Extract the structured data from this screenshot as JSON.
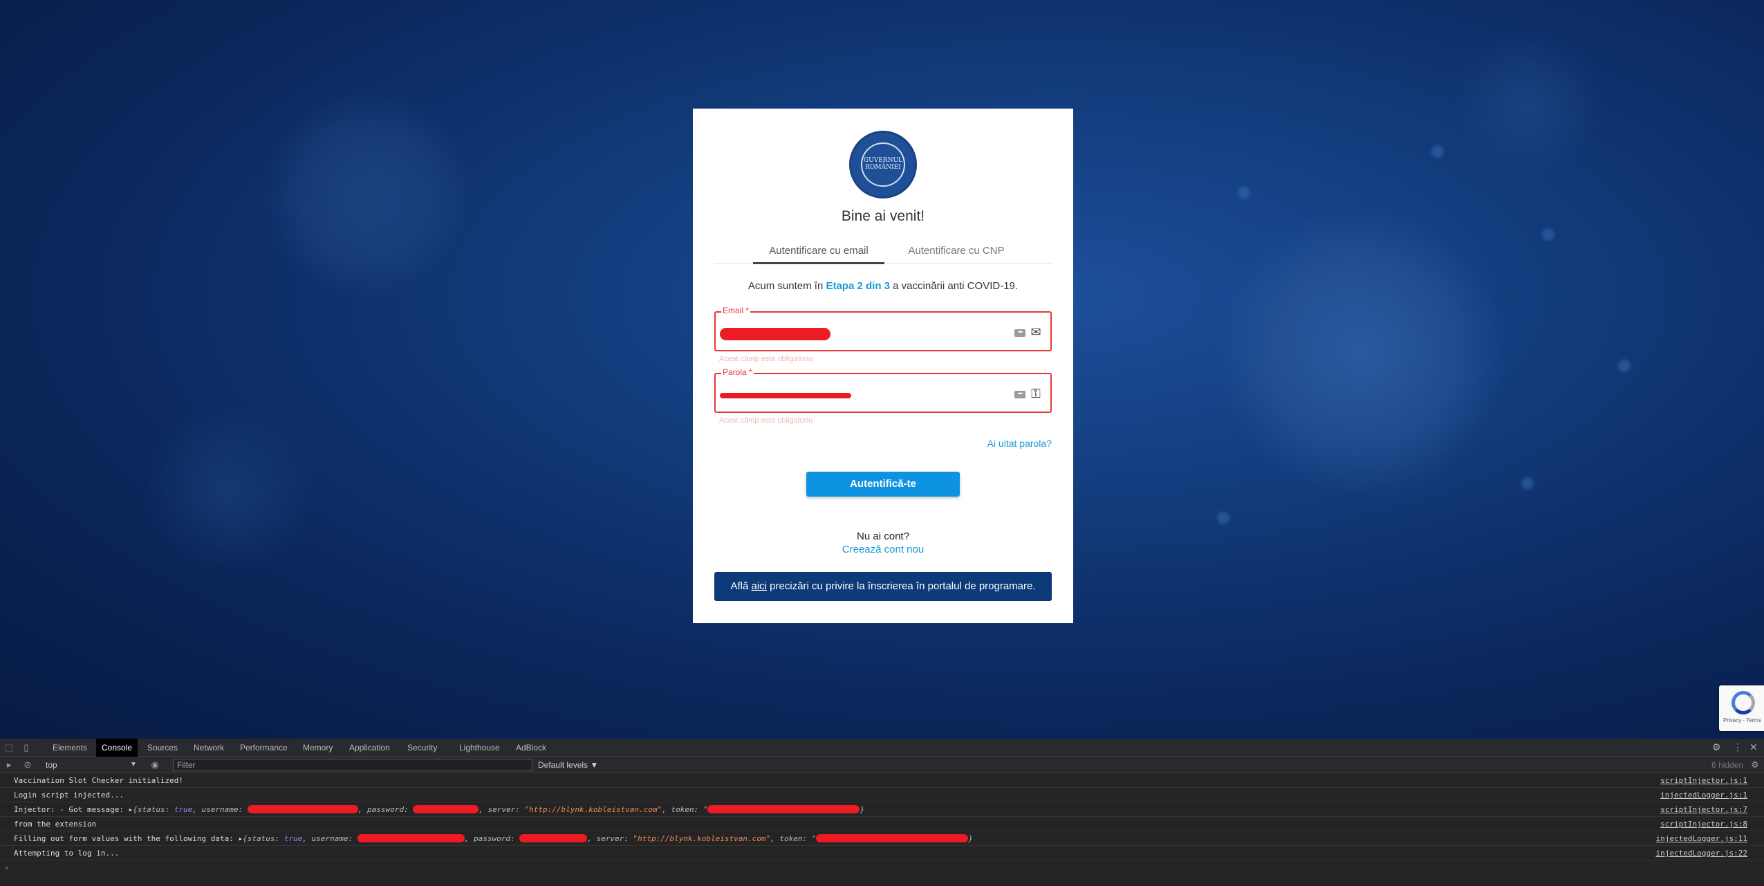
{
  "login": {
    "logo_text": "GUVERNUL ROMÂNIEI",
    "welcome": "Bine ai venit!",
    "tabs": [
      "Autentificare cu email",
      "Autentificare cu CNP"
    ],
    "stage_prefix": "Acum suntem în ",
    "stage_highlight": "Etapa 2 din 3",
    "stage_suffix": " a vaccinării anti COVID-19.",
    "email_label": "Email *",
    "password_label": "Parola *",
    "field_helper": "Acest câmp este obligatoriu",
    "forgot_password": "Ai uitat parola?",
    "login_button": "Autentifică-te",
    "no_account": "Nu ai cont?",
    "create_account": "Creează cont nou",
    "banner_prefix": "Află ",
    "banner_link": "aici",
    "banner_suffix": " precizări cu privire la înscrierea în portalul de programare."
  },
  "recaptcha": {
    "text": "Privacy - Terms"
  },
  "devtools": {
    "tabs": [
      "Elements",
      "Console",
      "Sources",
      "Network",
      "Performance",
      "Memory",
      "Application",
      "Security",
      "Lighthouse",
      "AdBlock"
    ],
    "active_tab": "Console",
    "context": "top",
    "filter_placeholder": "Filter",
    "levels": "Default levels ▼",
    "hidden": "6 hidden",
    "logs": [
      {
        "text": "Vaccination Slot Checker initialized!",
        "source": "scriptInjector.js:1"
      },
      {
        "text": "Login script injected...",
        "source": "injectedLogger.js:1"
      },
      {
        "text": "Injector: -  Got message: ",
        "source": "scriptInjector.js:7"
      },
      {
        "text": "from the extension",
        "source": "scriptInjector.js:8"
      },
      {
        "text": "Filling out form values with the following data: ",
        "source": "injectedLogger.js:11"
      },
      {
        "text": "Attempting to log in...",
        "source": "injectedLogger.js:22"
      }
    ],
    "object_parts": {
      "open": "{",
      "status_key": "status: ",
      "status_val": "true",
      "username_key": ", username: ",
      "password_key": ", password: ",
      "server_key": ", server: ",
      "server_val": "\"http://blynk.kobleistvan.com\"",
      "token_key": ", token: ",
      "token_quote": "\"",
      "close": "}"
    }
  },
  "colors": {
    "accent": "#1a9ad6",
    "button": "#0e93e0",
    "banner": "#0d3a78",
    "error": "#e53935",
    "redaction": "#ed1c24"
  }
}
